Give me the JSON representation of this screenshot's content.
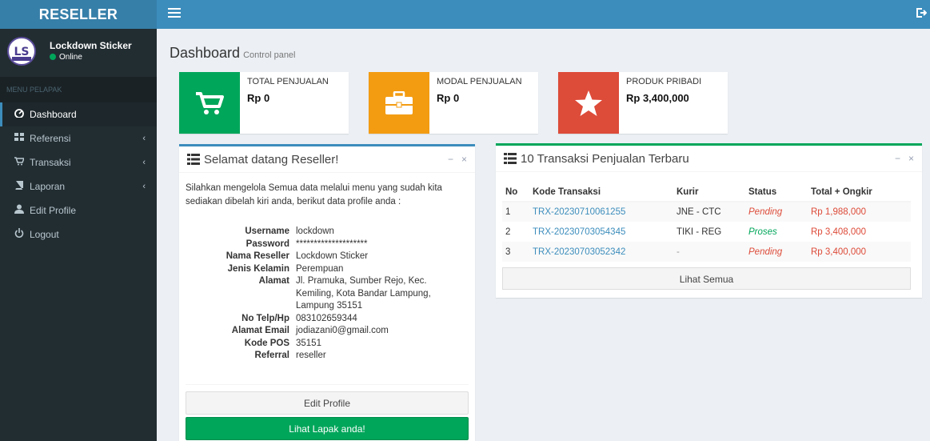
{
  "app": {
    "logo": "RESELLER"
  },
  "user": {
    "name": "Lockdown Sticker",
    "status": "Online"
  },
  "sidebar": {
    "header": "MENU PELAPAK",
    "items": [
      {
        "label": "Dashboard",
        "icon": "dashboard-icon"
      },
      {
        "label": "Referensi",
        "icon": "grid-icon"
      },
      {
        "label": "Transaksi",
        "icon": "cart-icon"
      },
      {
        "label": "Laporan",
        "icon": "book-icon"
      },
      {
        "label": "Edit Profile",
        "icon": "user-icon"
      },
      {
        "label": "Logout",
        "icon": "power-icon"
      }
    ]
  },
  "page": {
    "title": "Dashboard",
    "subtitle": "Control panel"
  },
  "stats": [
    {
      "label": "TOTAL PENJUALAN",
      "value": "Rp 0",
      "color": "#00a65a",
      "icon": "cart-icon"
    },
    {
      "label": "MODAL PENJUALAN",
      "value": "Rp 0",
      "color": "#f39c12",
      "icon": "briefcase-icon"
    },
    {
      "label": "PRODUK PRIBADI",
      "value": "Rp 3,400,000",
      "color": "#dd4b39",
      "icon": "star-icon"
    }
  ],
  "welcome": {
    "title": "Selamat datang Reseller!",
    "text": "Silahkan mengelola Semua data melalui menu yang sudah kita sediakan dibelah kiri anda, berikut data profile anda :",
    "profile": [
      {
        "key": "Username",
        "value": "lockdown"
      },
      {
        "key": "Password",
        "value": "********************"
      },
      {
        "key": "Nama Reseller",
        "value": "Lockdown Sticker"
      },
      {
        "key": "Jenis Kelamin",
        "value": "Perempuan"
      },
      {
        "key": "Alamat",
        "value": "Jl. Pramuka, Sumber Rejo, Kec. Kemiling, Kota Bandar Lampung, Lampung 35151"
      },
      {
        "key": "No Telp/Hp",
        "value": "083102659344"
      },
      {
        "key": "Alamat Email",
        "value": "jodiazani0@gmail.com"
      },
      {
        "key": "Kode POS",
        "value": "35151"
      },
      {
        "key": "Referral",
        "value": "reseller"
      }
    ],
    "edit_button": "Edit Profile",
    "lapak_button": "Lihat Lapak anda!"
  },
  "transactions": {
    "title": "10 Transaksi Penjualan Terbaru",
    "headers": [
      "No",
      "Kode Transaksi",
      "Kurir",
      "Status",
      "Total + Ongkir"
    ],
    "rows": [
      {
        "no": "1",
        "kode": "TRX-20230710061255",
        "kurir": "JNE - CTC",
        "status": "Pending",
        "total": "Rp 1,988,000"
      },
      {
        "no": "2",
        "kode": "TRX-20230703054345",
        "kurir": "TIKI - REG",
        "status": "Proses",
        "total": "Rp 3,408,000"
      },
      {
        "no": "3",
        "kode": "TRX-20230703052342",
        "kurir": "-",
        "status": "Pending",
        "total": "Rp 3,400,000"
      }
    ],
    "footer_button": "Lihat Semua"
  },
  "box_tools": {
    "minimize": "−",
    "close": "×"
  }
}
